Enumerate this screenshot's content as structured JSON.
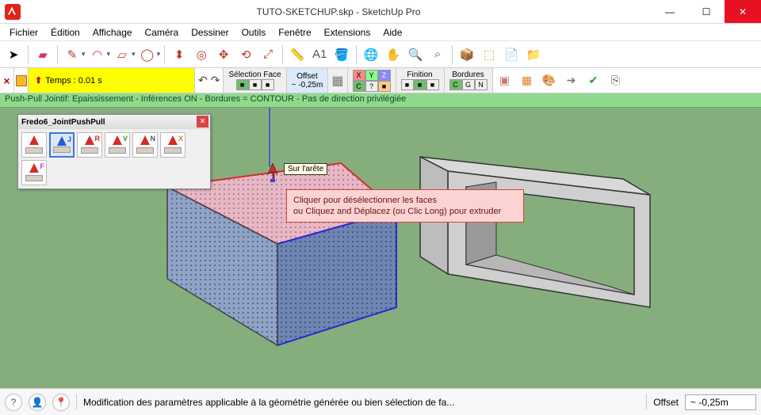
{
  "title": "TUTO-SKETCHUP.skp - SketchUp Pro",
  "menu": [
    "Fichier",
    "Édition",
    "Affichage",
    "Caméra",
    "Dessiner",
    "Outils",
    "Fenêtre",
    "Extensions",
    "Aide"
  ],
  "timer": "Temps : 0.01 s",
  "panels": {
    "selection": {
      "label": "Sélection Face",
      "opts": "■■■"
    },
    "offset": {
      "label": "Offset",
      "value": "~ -0,25m"
    },
    "xyz": {
      "x": "X",
      "y": "Y",
      "z": "Z",
      "c": "C",
      "q": "?"
    },
    "finition": {
      "label": "Finition",
      "opts": "■ ■ ■"
    },
    "bordures": {
      "label": "Bordures",
      "c": "C",
      "g": "G",
      "n": "N"
    }
  },
  "greenbar": "Push-Pull Jointif: Epaississement - Inférences ON - Bordures = CONTOUR - Pas de direction privilégiée",
  "fredo": {
    "title": "Fredo6_JointPushPull",
    "tags": [
      "",
      "J",
      "R",
      "V",
      "N",
      "X",
      "F"
    ]
  },
  "tip_arete": "Sur l'arête",
  "hint_line1": "Cliquer pour désélectionner les faces",
  "hint_line2": "ou Cliquez and Déplacez (ou Clic Long) pour extruder",
  "status": {
    "text": "Modification des paramètres applicable à la géométrie générée ou bien sélection de fa...",
    "offset_label": "Offset",
    "offset_value": "~ -0,25m"
  }
}
